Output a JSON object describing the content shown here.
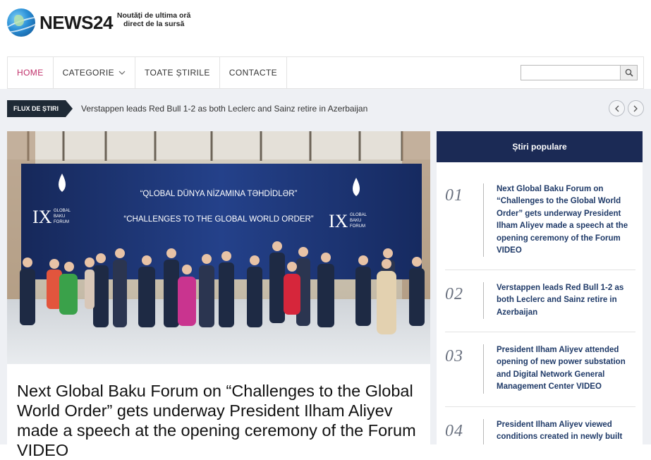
{
  "header": {
    "logo_text": "NEWS24",
    "tagline_line1": "Noutăți de ultima oră",
    "tagline_line2": "direct de la sursă"
  },
  "nav": {
    "items": [
      {
        "label": "HOME"
      },
      {
        "label": "CATEGORIE"
      },
      {
        "label": "TOATE ȘTIRILE"
      },
      {
        "label": "CONTACTE"
      }
    ],
    "search_value": ""
  },
  "ticker": {
    "label": "FLUX DE ȘTIRI",
    "text": "Verstappen leads Red Bull 1-2 as both Leclerc and Sainz retire in Azerbaijan"
  },
  "featured": {
    "banner_line1": "“QLOBAL DÜNYA NİZAMINA TƏHDİDLƏR”",
    "banner_line2": "“CHALLENGES TO THE GLOBAL WORLD ORDER”",
    "forum_numeral": "IX",
    "forum_name_1": "GLOBAL",
    "forum_name_2": "BAKU",
    "forum_name_3": "FORUM",
    "headline": "Next Global Baku Forum on “Challenges to the Global World Order” gets underway President Ilham Aliyev made a speech at the opening ceremony of the Forum VIDEO"
  },
  "sidebar": {
    "title": "Știri populare",
    "items": [
      {
        "num": "01",
        "text": "Next Global Baku Forum on “Challenges to the Global World Order” gets underway President Ilham Aliyev made a speech at the opening ceremony of the Forum VIDEO"
      },
      {
        "num": "02",
        "text": "Verstappen leads Red Bull 1-2 as both Leclerc and Sainz retire in Azerbaijan"
      },
      {
        "num": "03",
        "text": "President Ilham Aliyev attended opening of new power substation and Digital Network General Management Center VIDEO"
      },
      {
        "num": "04",
        "text": "President Ilham Aliyev viewed conditions created in newly built"
      }
    ]
  },
  "colors": {
    "nav_active": "#c0306a",
    "sidebar_header": "#1b2a55",
    "ticker_label": "#1f2a36",
    "link": "#1f3a68"
  }
}
